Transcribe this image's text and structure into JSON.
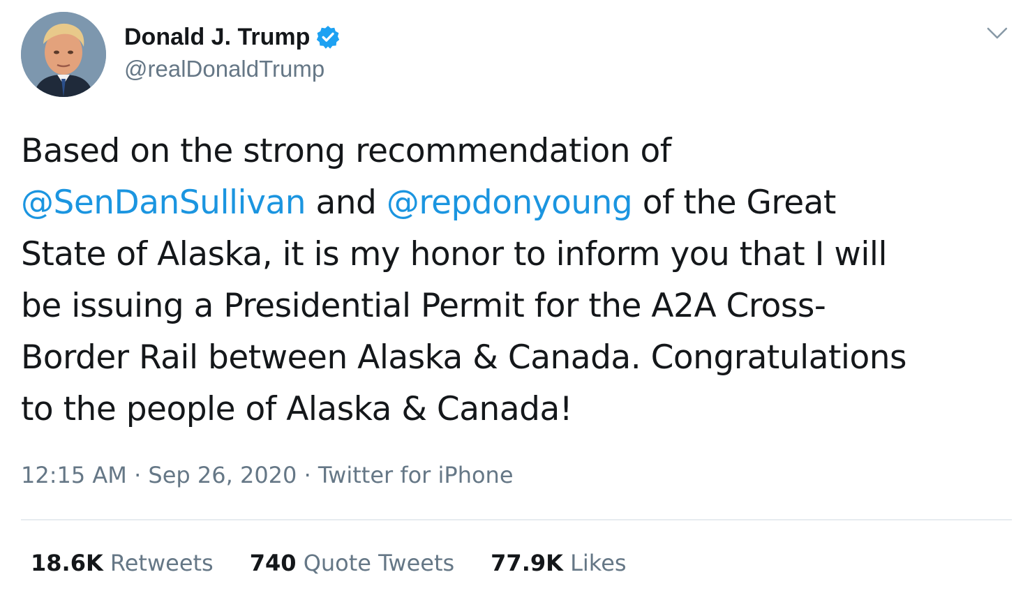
{
  "author": {
    "display_name": "Donald J. Trump",
    "handle": "@realDonaldTrump",
    "verified": true,
    "avatar_icon": "profile-photo",
    "verified_icon": "verified-badge-icon"
  },
  "tweet": {
    "lines": [
      [
        {
          "text": "Based on the strong recommendation of"
        }
      ],
      [
        {
          "text": "@SenDanSullivan",
          "mention": true
        },
        {
          "text": " and "
        },
        {
          "text": "@repdonyoung",
          "mention": true
        },
        {
          "text": " of the Great"
        }
      ],
      [
        {
          "text": "State of Alaska, it is my honor to inform you that I will"
        }
      ],
      [
        {
          "text": "be issuing a Presidential Permit for the A2A Cross-"
        }
      ],
      [
        {
          "text": "Border Rail between Alaska & Canada. Congratulations"
        }
      ],
      [
        {
          "text": "to the people of Alaska & Canada!"
        }
      ]
    ]
  },
  "meta": {
    "time": "12:15 AM",
    "separator": " · ",
    "date": "Sep 26, 2020",
    "source": "Twitter for iPhone"
  },
  "stats": {
    "retweets": {
      "count": "18.6K",
      "label": " Retweets"
    },
    "quote_tweets": {
      "count": "740",
      "label": " Quote Tweets"
    },
    "likes": {
      "count": "77.9K",
      "label": " Likes"
    }
  },
  "colors": {
    "mention": "#1b95e0",
    "verified": "#1da1f2",
    "secondary_text": "#657786",
    "primary_text": "#14171a",
    "divider": "#e6ecf0"
  }
}
